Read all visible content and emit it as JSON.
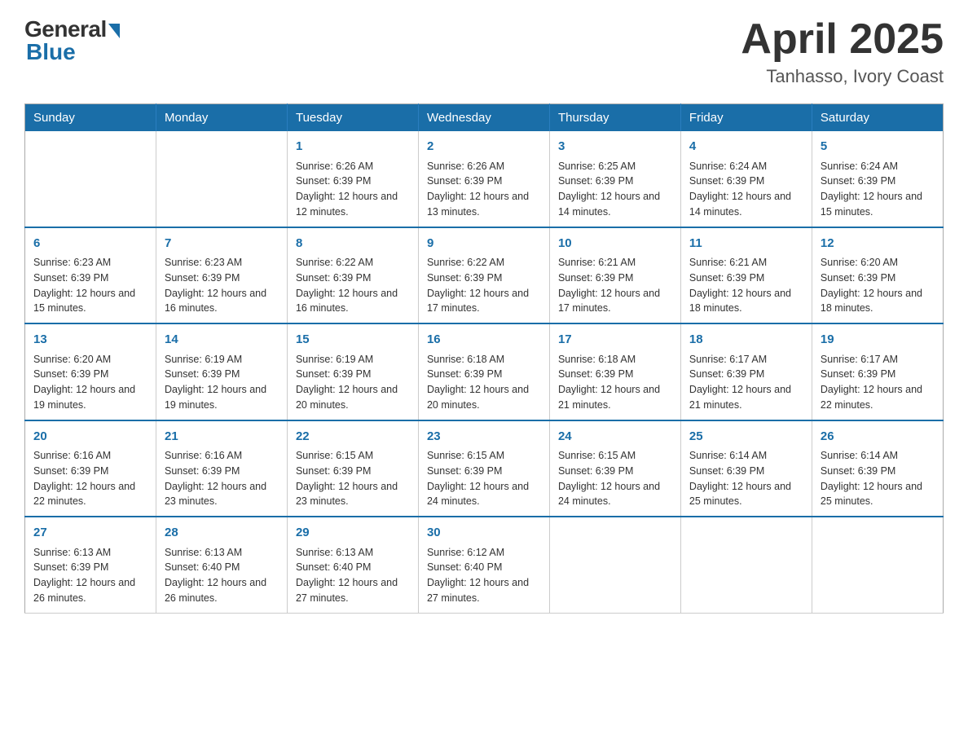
{
  "logo": {
    "general": "General",
    "blue": "Blue"
  },
  "title": {
    "month": "April 2025",
    "location": "Tanhasso, Ivory Coast"
  },
  "weekdays": [
    "Sunday",
    "Monday",
    "Tuesday",
    "Wednesday",
    "Thursday",
    "Friday",
    "Saturday"
  ],
  "weeks": [
    [
      {
        "day": "",
        "sunrise": "",
        "sunset": "",
        "daylight": ""
      },
      {
        "day": "",
        "sunrise": "",
        "sunset": "",
        "daylight": ""
      },
      {
        "day": "1",
        "sunrise": "Sunrise: 6:26 AM",
        "sunset": "Sunset: 6:39 PM",
        "daylight": "Daylight: 12 hours and 12 minutes."
      },
      {
        "day": "2",
        "sunrise": "Sunrise: 6:26 AM",
        "sunset": "Sunset: 6:39 PM",
        "daylight": "Daylight: 12 hours and 13 minutes."
      },
      {
        "day": "3",
        "sunrise": "Sunrise: 6:25 AM",
        "sunset": "Sunset: 6:39 PM",
        "daylight": "Daylight: 12 hours and 14 minutes."
      },
      {
        "day": "4",
        "sunrise": "Sunrise: 6:24 AM",
        "sunset": "Sunset: 6:39 PM",
        "daylight": "Daylight: 12 hours and 14 minutes."
      },
      {
        "day": "5",
        "sunrise": "Sunrise: 6:24 AM",
        "sunset": "Sunset: 6:39 PM",
        "daylight": "Daylight: 12 hours and 15 minutes."
      }
    ],
    [
      {
        "day": "6",
        "sunrise": "Sunrise: 6:23 AM",
        "sunset": "Sunset: 6:39 PM",
        "daylight": "Daylight: 12 hours and 15 minutes."
      },
      {
        "day": "7",
        "sunrise": "Sunrise: 6:23 AM",
        "sunset": "Sunset: 6:39 PM",
        "daylight": "Daylight: 12 hours and 16 minutes."
      },
      {
        "day": "8",
        "sunrise": "Sunrise: 6:22 AM",
        "sunset": "Sunset: 6:39 PM",
        "daylight": "Daylight: 12 hours and 16 minutes."
      },
      {
        "day": "9",
        "sunrise": "Sunrise: 6:22 AM",
        "sunset": "Sunset: 6:39 PM",
        "daylight": "Daylight: 12 hours and 17 minutes."
      },
      {
        "day": "10",
        "sunrise": "Sunrise: 6:21 AM",
        "sunset": "Sunset: 6:39 PM",
        "daylight": "Daylight: 12 hours and 17 minutes."
      },
      {
        "day": "11",
        "sunrise": "Sunrise: 6:21 AM",
        "sunset": "Sunset: 6:39 PM",
        "daylight": "Daylight: 12 hours and 18 minutes."
      },
      {
        "day": "12",
        "sunrise": "Sunrise: 6:20 AM",
        "sunset": "Sunset: 6:39 PM",
        "daylight": "Daylight: 12 hours and 18 minutes."
      }
    ],
    [
      {
        "day": "13",
        "sunrise": "Sunrise: 6:20 AM",
        "sunset": "Sunset: 6:39 PM",
        "daylight": "Daylight: 12 hours and 19 minutes."
      },
      {
        "day": "14",
        "sunrise": "Sunrise: 6:19 AM",
        "sunset": "Sunset: 6:39 PM",
        "daylight": "Daylight: 12 hours and 19 minutes."
      },
      {
        "day": "15",
        "sunrise": "Sunrise: 6:19 AM",
        "sunset": "Sunset: 6:39 PM",
        "daylight": "Daylight: 12 hours and 20 minutes."
      },
      {
        "day": "16",
        "sunrise": "Sunrise: 6:18 AM",
        "sunset": "Sunset: 6:39 PM",
        "daylight": "Daylight: 12 hours and 20 minutes."
      },
      {
        "day": "17",
        "sunrise": "Sunrise: 6:18 AM",
        "sunset": "Sunset: 6:39 PM",
        "daylight": "Daylight: 12 hours and 21 minutes."
      },
      {
        "day": "18",
        "sunrise": "Sunrise: 6:17 AM",
        "sunset": "Sunset: 6:39 PM",
        "daylight": "Daylight: 12 hours and 21 minutes."
      },
      {
        "day": "19",
        "sunrise": "Sunrise: 6:17 AM",
        "sunset": "Sunset: 6:39 PM",
        "daylight": "Daylight: 12 hours and 22 minutes."
      }
    ],
    [
      {
        "day": "20",
        "sunrise": "Sunrise: 6:16 AM",
        "sunset": "Sunset: 6:39 PM",
        "daylight": "Daylight: 12 hours and 22 minutes."
      },
      {
        "day": "21",
        "sunrise": "Sunrise: 6:16 AM",
        "sunset": "Sunset: 6:39 PM",
        "daylight": "Daylight: 12 hours and 23 minutes."
      },
      {
        "day": "22",
        "sunrise": "Sunrise: 6:15 AM",
        "sunset": "Sunset: 6:39 PM",
        "daylight": "Daylight: 12 hours and 23 minutes."
      },
      {
        "day": "23",
        "sunrise": "Sunrise: 6:15 AM",
        "sunset": "Sunset: 6:39 PM",
        "daylight": "Daylight: 12 hours and 24 minutes."
      },
      {
        "day": "24",
        "sunrise": "Sunrise: 6:15 AM",
        "sunset": "Sunset: 6:39 PM",
        "daylight": "Daylight: 12 hours and 24 minutes."
      },
      {
        "day": "25",
        "sunrise": "Sunrise: 6:14 AM",
        "sunset": "Sunset: 6:39 PM",
        "daylight": "Daylight: 12 hours and 25 minutes."
      },
      {
        "day": "26",
        "sunrise": "Sunrise: 6:14 AM",
        "sunset": "Sunset: 6:39 PM",
        "daylight": "Daylight: 12 hours and 25 minutes."
      }
    ],
    [
      {
        "day": "27",
        "sunrise": "Sunrise: 6:13 AM",
        "sunset": "Sunset: 6:39 PM",
        "daylight": "Daylight: 12 hours and 26 minutes."
      },
      {
        "day": "28",
        "sunrise": "Sunrise: 6:13 AM",
        "sunset": "Sunset: 6:40 PM",
        "daylight": "Daylight: 12 hours and 26 minutes."
      },
      {
        "day": "29",
        "sunrise": "Sunrise: 6:13 AM",
        "sunset": "Sunset: 6:40 PM",
        "daylight": "Daylight: 12 hours and 27 minutes."
      },
      {
        "day": "30",
        "sunrise": "Sunrise: 6:12 AM",
        "sunset": "Sunset: 6:40 PM",
        "daylight": "Daylight: 12 hours and 27 minutes."
      },
      {
        "day": "",
        "sunrise": "",
        "sunset": "",
        "daylight": ""
      },
      {
        "day": "",
        "sunrise": "",
        "sunset": "",
        "daylight": ""
      },
      {
        "day": "",
        "sunrise": "",
        "sunset": "",
        "daylight": ""
      }
    ]
  ]
}
